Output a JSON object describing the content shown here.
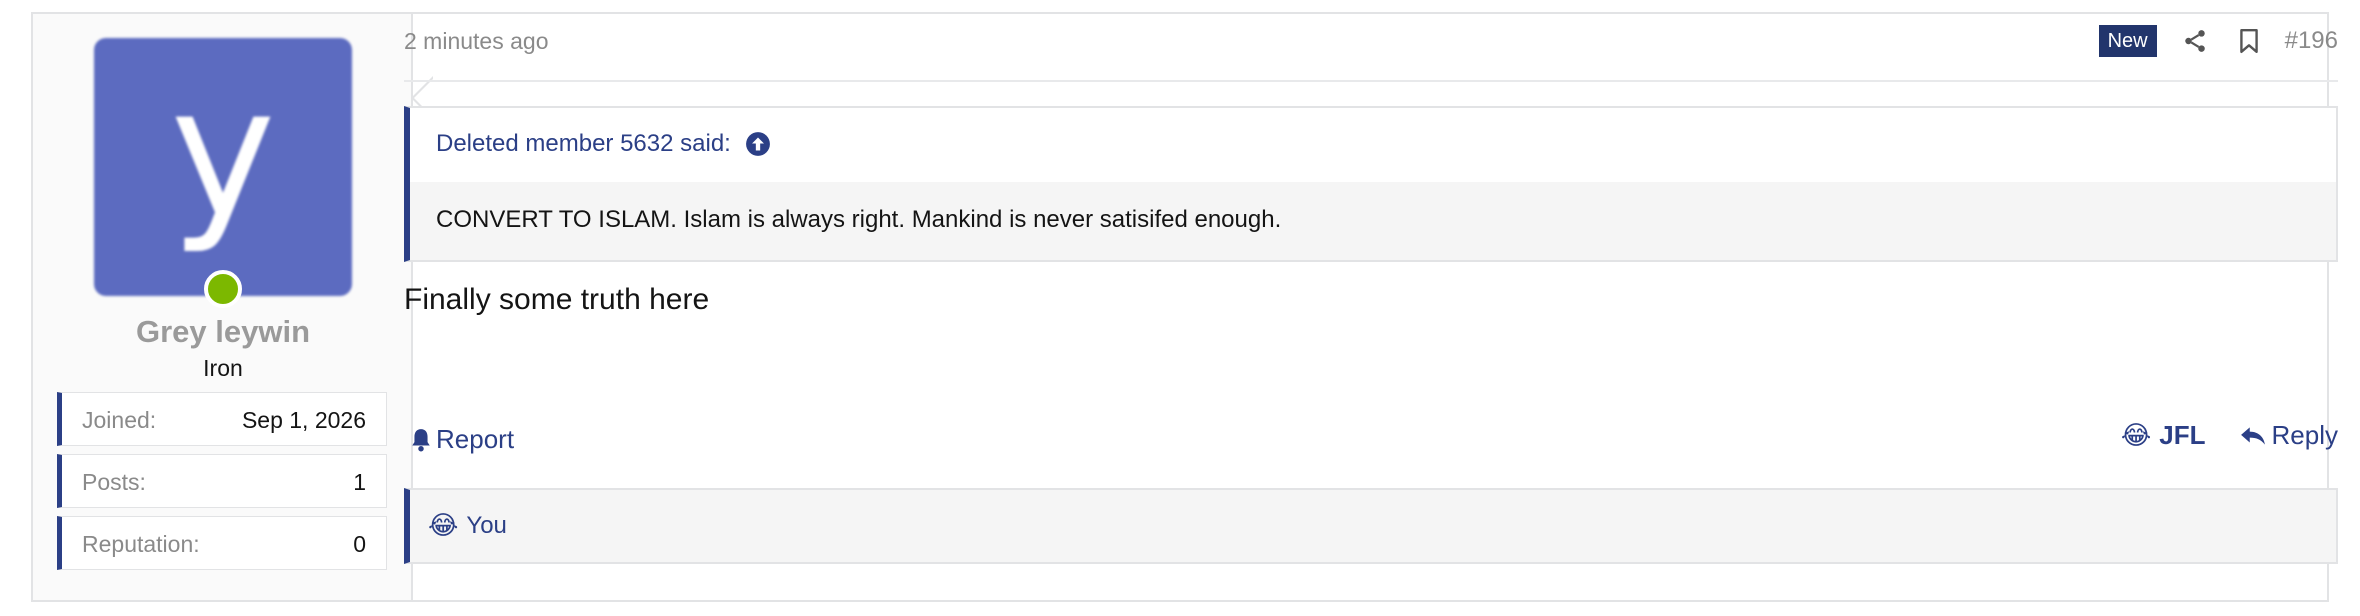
{
  "user": {
    "avatar_letter": "y",
    "avatar_color": "#5c6bc0",
    "online_status_color": "#7cb800",
    "name": "Grey leywin",
    "title": "Iron",
    "stats": [
      {
        "label": "Joined:",
        "value": "Sep 1, 2026"
      },
      {
        "label": "Posts:",
        "value": "1"
      },
      {
        "label": "Reputation:",
        "value": "0"
      }
    ]
  },
  "post": {
    "time": "2 minutes ago",
    "badge": "New",
    "number": "#196",
    "quote": {
      "author_line": "Deleted member 5632 said:",
      "text": "CONVERT TO ISLAM. Islam is always right. Mankind is never satisifed enough."
    },
    "message": "Finally some truth here"
  },
  "actions": {
    "report_label": "Report",
    "reaction_emoji": "😂",
    "reaction_label": "JFL",
    "reply_label": "Reply"
  },
  "reactions_bar": {
    "emoji": "😂",
    "text": "You"
  },
  "colors": {
    "accent": "#2b3f86",
    "badge_bg": "#22356c"
  },
  "icons": {
    "share": "share-icon",
    "bookmark": "bookmark-icon",
    "quote_jump": "arrow-up-circle-icon",
    "report": "bell-icon",
    "reply": "reply-icon"
  }
}
